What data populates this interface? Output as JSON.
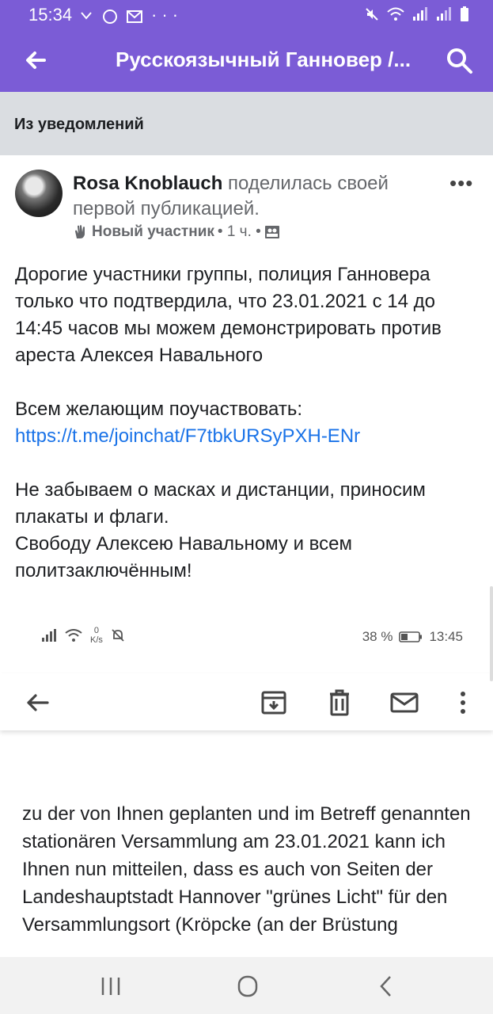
{
  "status_bar": {
    "time": "15:34",
    "dots": "···"
  },
  "app_bar": {
    "title": "Русскоязычный Ганновер /..."
  },
  "notice": {
    "label": "Из уведомлений"
  },
  "post": {
    "author": "Rosa Knoblauch",
    "action": "поделилась своей первой публикацией.",
    "badge": "Новый участник",
    "time": "• 1 ч. •",
    "more": "•••",
    "paragraph1": "Дорогие участники группы, полиция Ганновера только что подтвердила, что 23.01.2021 с 14 до 14:45 часов мы можем демонстрировать против ареста Алексея Навального",
    "paragraph2": "Всем желающим поучаствовать:",
    "link": "https://t.me/joinchat/F7tbkURSyPXH-ENr",
    "paragraph3": "Не забываем о масках и дистанции, приносим плакаты и флаги.",
    "paragraph4": "Свободу Алексею Навальному и всем политзаключённым!"
  },
  "embedded": {
    "speed_value": "0",
    "speed_unit": "K/s",
    "battery": "38 %",
    "time": "13:45",
    "german_text": "zu der von Ihnen geplanten und im Betreff genannten stationären Versammlung am 23.01.2021 kann ich Ihnen nun mitteilen, dass es auch von Seiten der Landeshauptstadt Hannover \"grünes Licht\" für den Versammlungsort (Kröpcke (an der Brüstung"
  },
  "colors": {
    "app_bar": "#7b5cd6",
    "notice_bg": "#dadde1",
    "link": "#1a73e8"
  }
}
